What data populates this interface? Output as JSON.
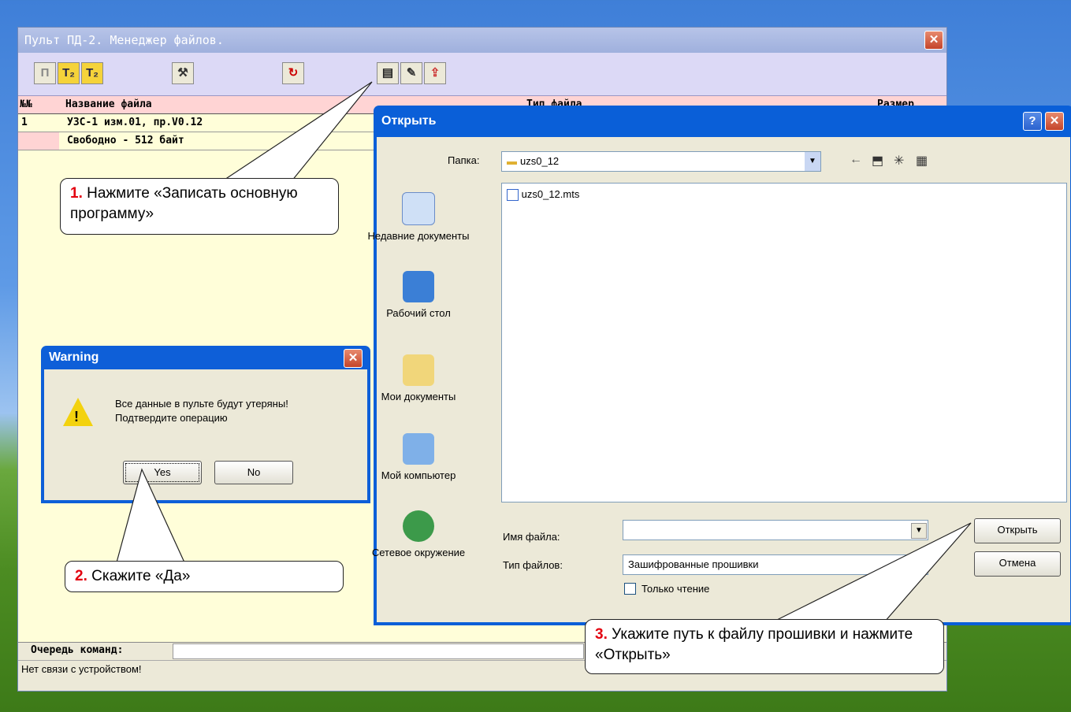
{
  "main_window": {
    "title": "Пульт ПД-2. Менеджер файлов.",
    "close_icon": "close-icon",
    "toolbar_icons": [
      "pd-mode-icon",
      "t2-mode-icon",
      "t2-alt-icon",
      "tools-icon",
      "refresh-icon",
      "write-main-program-icon",
      "download-icon",
      "upload-icon"
    ],
    "table": {
      "headers": [
        "№№",
        "Название файла",
        "Тип файла",
        "Размер"
      ],
      "rows": [
        {
          "num": "1",
          "name": "УЗС-1 изм.01, пр.V0.12"
        },
        {
          "num": "",
          "name": "Свободно - 512 байт"
        }
      ]
    },
    "queue_label": "Очередь команд:",
    "status": "Нет связи с устройством!"
  },
  "warning_dialog": {
    "title": "Warning",
    "message_line1": "Все данные в пульте будут утеряны!",
    "message_line2": "Подтвердите операцию",
    "yes_label": "Yes",
    "no_label": "No"
  },
  "open_dialog": {
    "title": "Открыть",
    "folder_label": "Папка:",
    "folder_value": "uzs0_12",
    "files": [
      "uzs0_12.mts"
    ],
    "places": [
      "Недавние документы",
      "Рабочий стол",
      "Мои документы",
      "Мой компьютер",
      "Сетевое окружение"
    ],
    "filename_label": "Имя файла:",
    "filename_value": "",
    "filetype_label": "Тип файлов:",
    "filetype_value": "Зашифрованные прошивки",
    "readonly_label": "Только чтение",
    "open_label": "Открыть",
    "cancel_label": "Отмена"
  },
  "callouts": [
    {
      "num": "1.",
      "text": "Нажмите «Записать основную программу»"
    },
    {
      "num": "2.",
      "text": "Скажите «Да»"
    },
    {
      "num": "3.",
      "text": "Укажите путь к файлу прошивки и нажмите «Открыть»"
    }
  ]
}
